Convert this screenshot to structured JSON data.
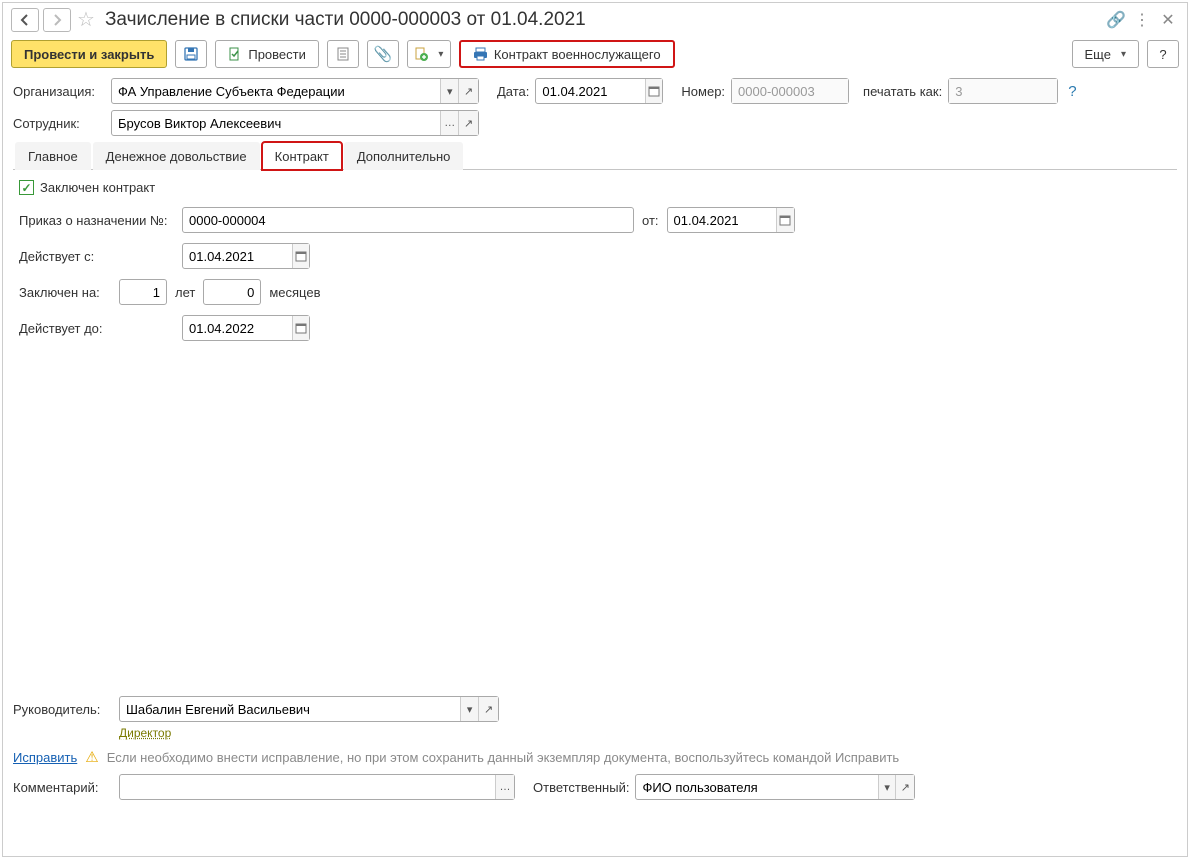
{
  "title": "Зачисление в списки части 0000-000003 от 01.04.2021",
  "toolbar": {
    "post_close": "Провести и закрыть",
    "post": "Провести",
    "contract_btn": "Контракт военнослужащего",
    "more": "Еще",
    "help": "?"
  },
  "header": {
    "org_label": "Организация:",
    "org_value": "ФА Управление Субъекта Федерации",
    "date_label": "Дата:",
    "date_value": "01.04.2021",
    "num_label": "Номер:",
    "num_value": "0000-000003",
    "printas_label": "печатать как:",
    "printas_value": "3",
    "emp_label": "Сотрудник:",
    "emp_value": "Брусов Виктор Алексеевич"
  },
  "tabs": [
    "Главное",
    "Денежное довольствие",
    "Контракт",
    "Дополнительно"
  ],
  "contract": {
    "checkbox_label": "Заключен контракт",
    "order_label": "Приказ о назначении №:",
    "order_value": "0000-000004",
    "ot_label": "от:",
    "ot_value": "01.04.2021",
    "valid_from_label": "Действует с:",
    "valid_from_value": "01.04.2021",
    "term_label": "Заключен на:",
    "years_value": "1",
    "years_unit": "лет",
    "months_value": "0",
    "months_unit": "месяцев",
    "valid_to_label": "Действует до:",
    "valid_to_value": "01.04.2022"
  },
  "footer": {
    "manager_label": "Руководитель:",
    "manager_value": "Шабалин Евгений Васильевич",
    "manager_position": "Директор",
    "fix_link": "Исправить",
    "hint": "Если необходимо внести исправление, но при этом сохранить данный экземпляр документа, воспользуйтесь командой Исправить",
    "comment_label": "Комментарий:",
    "responsible_label": "Ответственный:",
    "responsible_value": "ФИО пользователя"
  }
}
